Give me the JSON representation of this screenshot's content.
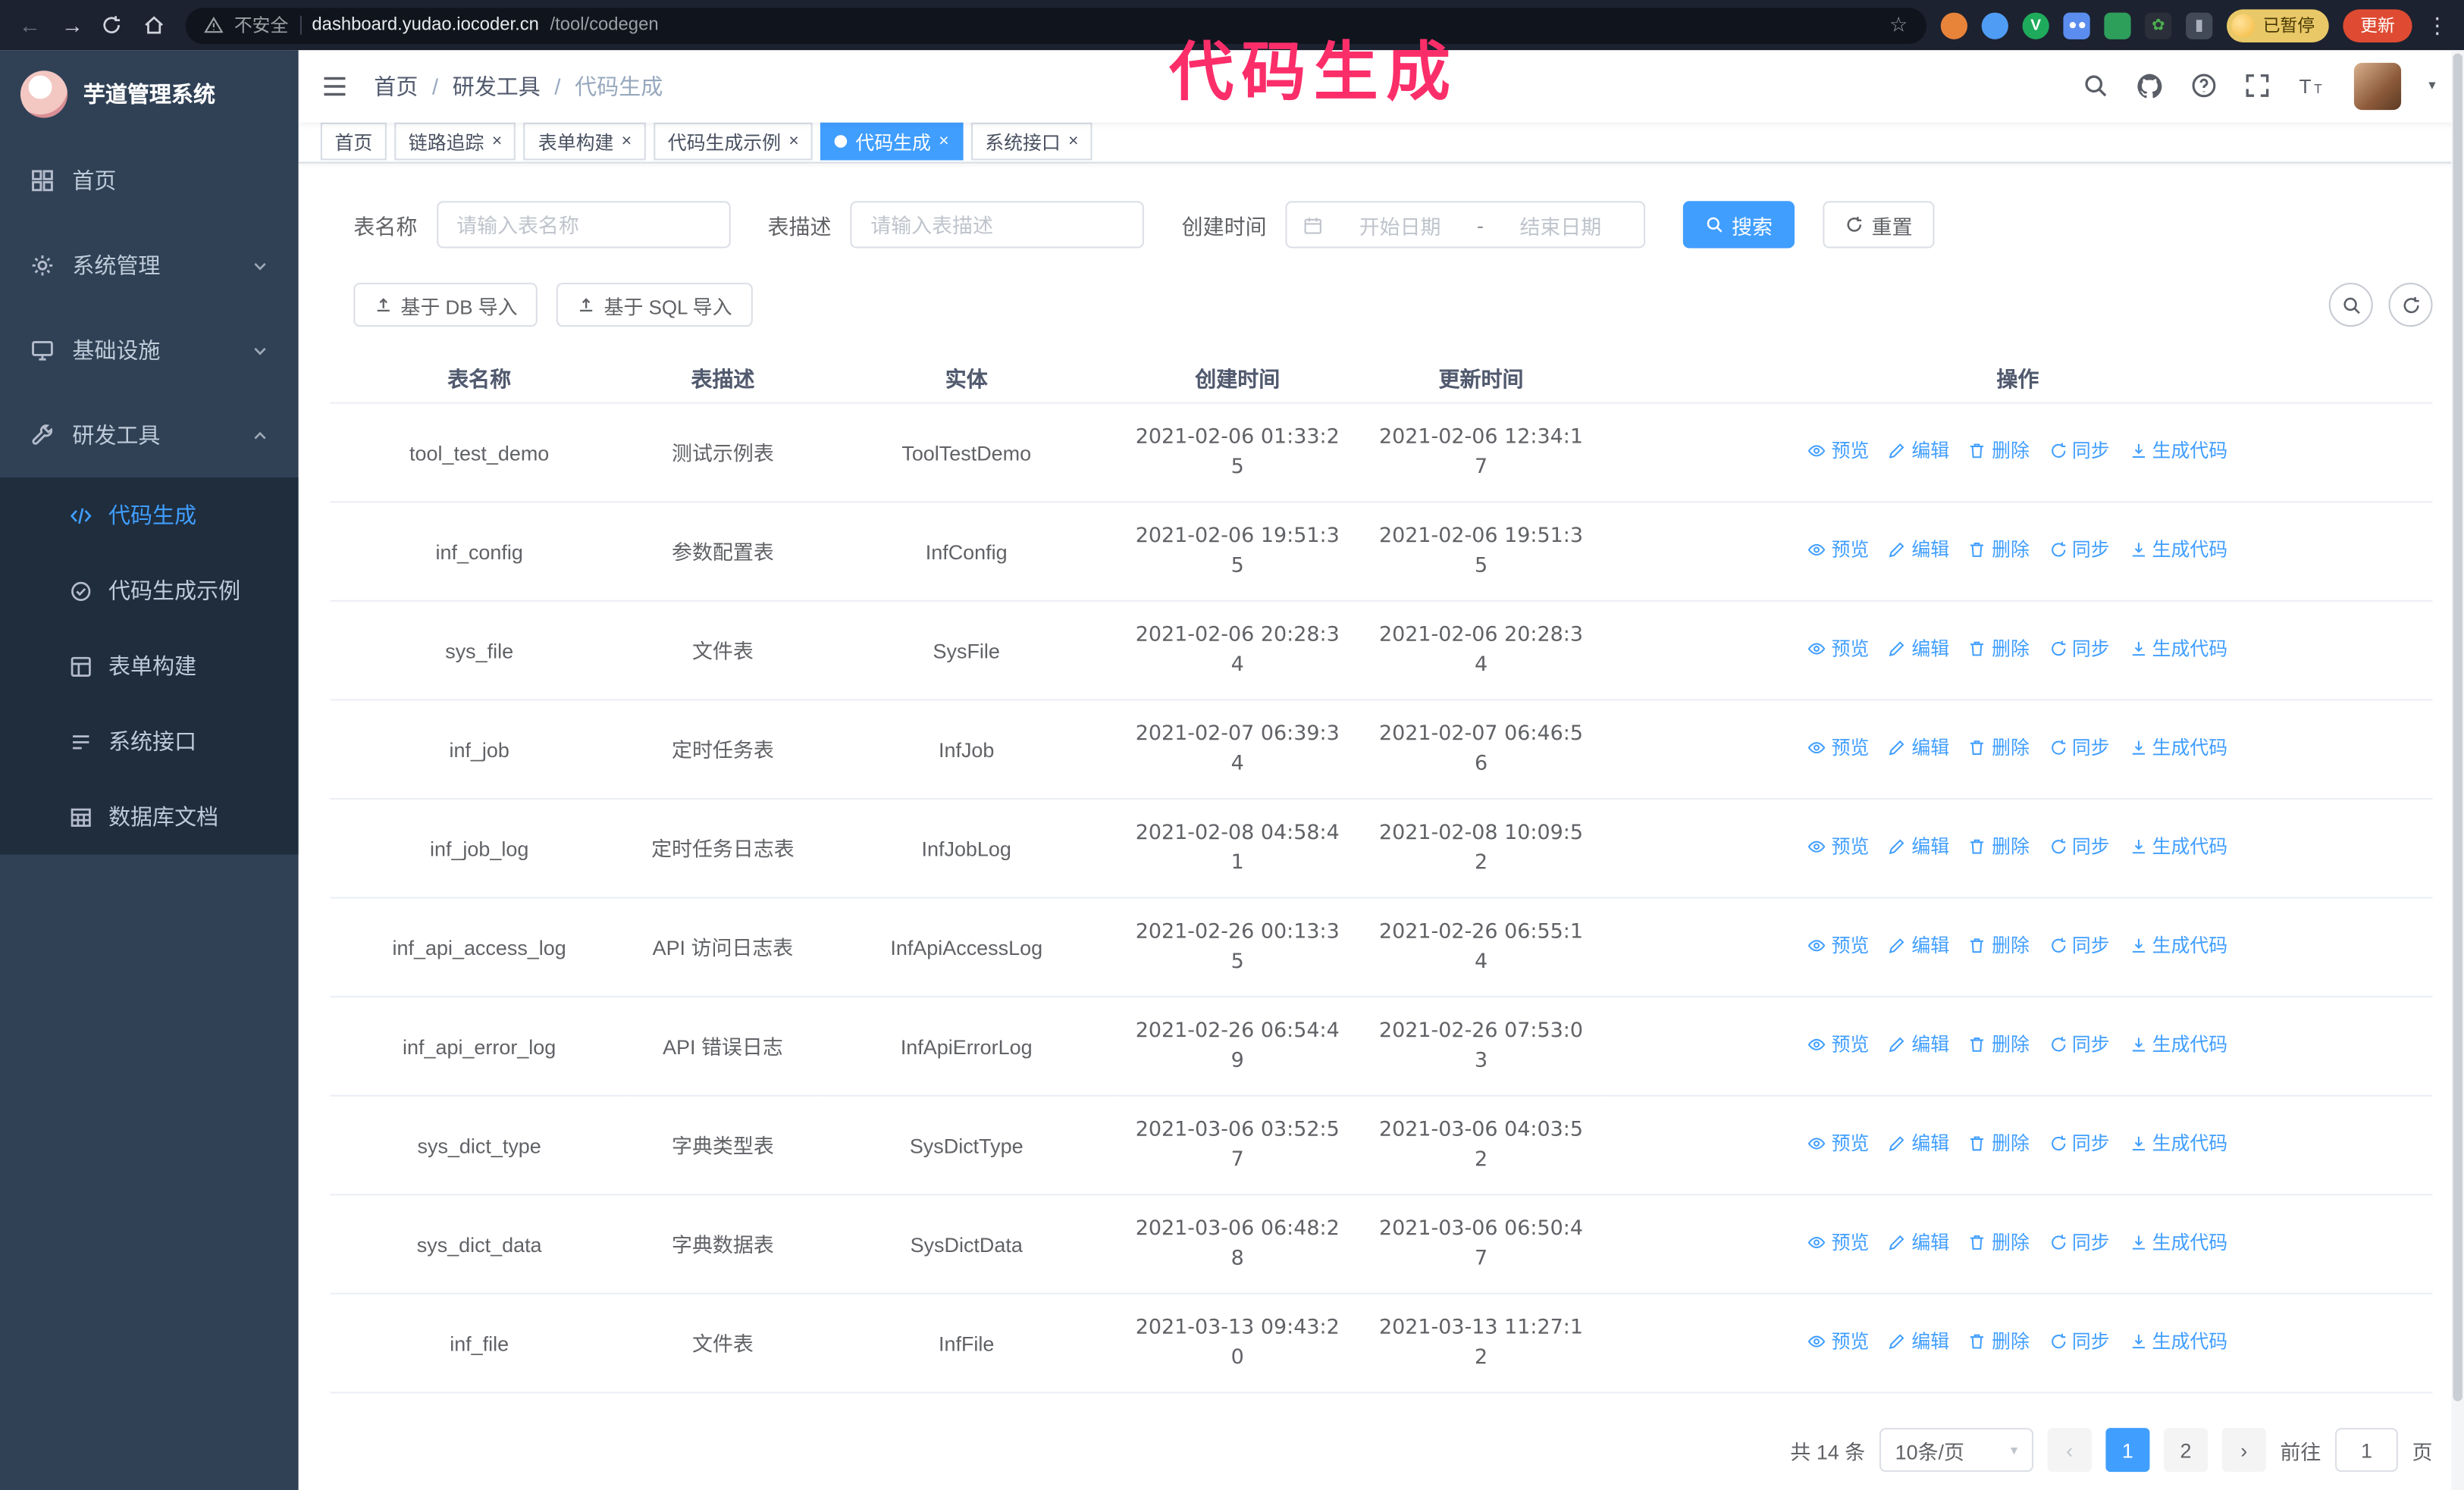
{
  "annotation": {
    "text": "代码生成",
    "color": "#fb2e6a"
  },
  "colors": {
    "primary": "#409eff",
    "sidebar_bg": "#304156",
    "submenu_bg": "#1f2d3d",
    "update_badge": "#de4b32",
    "paused_badge": "#e9c867"
  },
  "browser": {
    "security_warning": "不安全",
    "url_domain": "dashboard.yudao.iocoder.cn",
    "url_path": "/tool/codegen",
    "paused_badge": "已暂停",
    "update_button": "更新"
  },
  "sidebar": {
    "logo_title": "芋道管理系统",
    "items": [
      {
        "label": "首页"
      },
      {
        "label": "系统管理"
      },
      {
        "label": "基础设施"
      },
      {
        "label": "研发工具"
      }
    ],
    "subitems": [
      {
        "label": "代码生成",
        "active": true
      },
      {
        "label": "代码生成示例"
      },
      {
        "label": "表单构建"
      },
      {
        "label": "系统接口"
      },
      {
        "label": "数据库文档"
      }
    ]
  },
  "header": {
    "breadcrumb": [
      "首页",
      "研发工具",
      "代码生成"
    ]
  },
  "tabs": [
    {
      "label": "首页",
      "closable": false
    },
    {
      "label": "链路追踪",
      "closable": true
    },
    {
      "label": "表单构建",
      "closable": true
    },
    {
      "label": "代码生成示例",
      "closable": true
    },
    {
      "label": "代码生成",
      "closable": true,
      "active": true
    },
    {
      "label": "系统接口",
      "closable": true
    }
  ],
  "filters": {
    "table_name_label": "表名称",
    "table_name_placeholder": "请输入表名称",
    "table_desc_label": "表描述",
    "table_desc_placeholder": "请输入表描述",
    "create_time_label": "创建时间",
    "date_start_placeholder": "开始日期",
    "date_separator": "-",
    "date_end_placeholder": "结束日期",
    "search_button": "搜索",
    "reset_button": "重置"
  },
  "toolbar": {
    "import_db": "基于 DB 导入",
    "import_sql": "基于 SQL 导入"
  },
  "table": {
    "columns": [
      "表名称",
      "表描述",
      "实体",
      "创建时间",
      "更新时间",
      "操作"
    ],
    "action_labels": [
      "预览",
      "编辑",
      "删除",
      "同步",
      "生成代码"
    ],
    "rows": [
      {
        "name": "tool_test_demo",
        "desc": "测试示例表",
        "entity": "ToolTestDemo",
        "created": "2021-02-06 01:33:25",
        "updated": "2021-02-06 12:34:17"
      },
      {
        "name": "inf_config",
        "desc": "参数配置表",
        "entity": "InfConfig",
        "created": "2021-02-06 19:51:35",
        "updated": "2021-02-06 19:51:35"
      },
      {
        "name": "sys_file",
        "desc": "文件表",
        "entity": "SysFile",
        "created": "2021-02-06 20:28:34",
        "updated": "2021-02-06 20:28:34"
      },
      {
        "name": "inf_job",
        "desc": "定时任务表",
        "entity": "InfJob",
        "created": "2021-02-07 06:39:34",
        "updated": "2021-02-07 06:46:56"
      },
      {
        "name": "inf_job_log",
        "desc": "定时任务日志表",
        "entity": "InfJobLog",
        "created": "2021-02-08 04:58:41",
        "updated": "2021-02-08 10:09:52"
      },
      {
        "name": "inf_api_access_log",
        "desc": "API 访问日志表",
        "entity": "InfApiAccessLog",
        "created": "2021-02-26 00:13:35",
        "updated": "2021-02-26 06:55:14"
      },
      {
        "name": "inf_api_error_log",
        "desc": "API 错误日志",
        "entity": "InfApiErrorLog",
        "created": "2021-02-26 06:54:49",
        "updated": "2021-02-26 07:53:03"
      },
      {
        "name": "sys_dict_type",
        "desc": "字典类型表",
        "entity": "SysDictType",
        "created": "2021-03-06 03:52:57",
        "updated": "2021-03-06 04:03:52"
      },
      {
        "name": "sys_dict_data",
        "desc": "字典数据表",
        "entity": "SysDictData",
        "created": "2021-03-06 06:48:28",
        "updated": "2021-03-06 06:50:47"
      },
      {
        "name": "inf_file",
        "desc": "文件表",
        "entity": "InfFile",
        "created": "2021-03-13 09:43:20",
        "updated": "2021-03-13 11:27:12"
      }
    ]
  },
  "pagination": {
    "total_text": "共 14 条",
    "page_size": "10条/页",
    "pages": [
      "1",
      "2"
    ],
    "active_page": "1",
    "goto_label": "前往",
    "goto_value": "1",
    "goto_suffix": "页"
  }
}
